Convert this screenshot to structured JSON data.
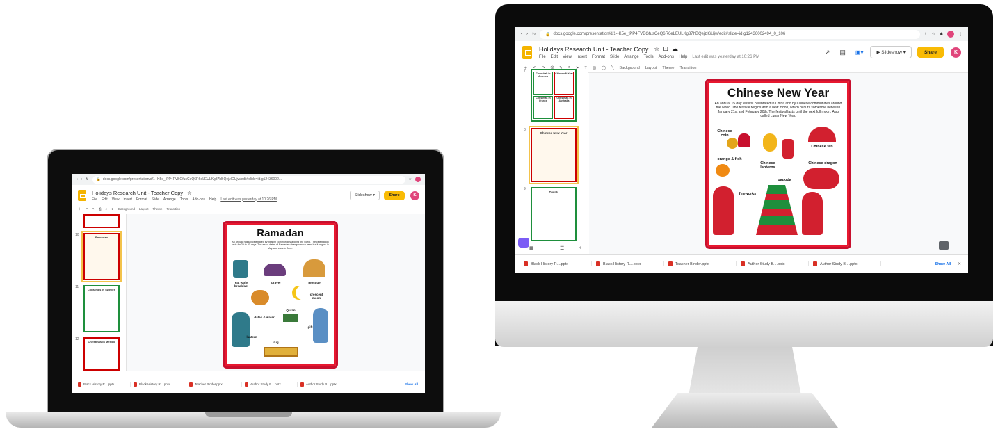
{
  "laptop": {
    "url": "docs.google.com/presentation/d/1--K5e_tPP4FVBGfusCeQ6R6eLEULKg87hBQejzlGUjw/edit#slide=id.g12436002...",
    "doc_title": "Holidays Research Unit - Teacher Copy",
    "menu": [
      "File",
      "Edit",
      "View",
      "Insert",
      "Format",
      "Slide",
      "Arrange",
      "Tools",
      "Add-ons",
      "Help"
    ],
    "last_edit": "Last edit was yesterday at 10:26 PM",
    "slideshow_label": "Slideshow",
    "share_label": "Share",
    "avatar_letter": "K",
    "toolbar_items": [
      "Background",
      "Layout",
      "Theme",
      "Transition"
    ],
    "slide_title": "Ramadan",
    "slide_desc": "An annual holiday celebrated by Muslim communities around the world. The celebration lasts for 29 to 30 days. The exact dates of Ramadan changes each year, but it begins in May and ends in June.",
    "labels": {
      "breakfast": "eat early breakfast",
      "prayer": "prayer",
      "mosque": "mosque",
      "moon": "crescent moon",
      "dates": "dates & water",
      "quran": "Quran",
      "gift": "gift",
      "lantern": "lantern",
      "rug": "rug"
    },
    "thumb_numbers": [
      "10",
      "11",
      "12"
    ],
    "thumb_titles": [
      "Ramadan",
      "Christmas in Sweden",
      "Christmas in Mexico"
    ],
    "downloads": [
      "Black History R....pptx",
      "Black History R....pptx",
      "Teacher Binder.pptx",
      "Author Study B....pptx",
      "Author Study B....pptx"
    ],
    "show_all": "Show All"
  },
  "monitor": {
    "url": "docs.google.com/presentation/d/1--K5e_tPP4FVBGfusCeQ6R6eLEULKg87hBQejzlGUjw/edit#slide=id.g12436002494_0_106",
    "doc_title": "Holidays Research Unit - Teacher Copy",
    "menu": [
      "File",
      "Edit",
      "View",
      "Insert",
      "Format",
      "Slide",
      "Arrange",
      "Tools",
      "Add-ons",
      "Help"
    ],
    "last_edit": "Last edit was yesterday at 10:26 PM",
    "slideshow_label": "Slideshow",
    "share_label": "Share",
    "avatar_letter": "K",
    "toolbar_items": [
      "Background",
      "Layout",
      "Theme",
      "Transition"
    ],
    "slide_title": "Chinese New Year",
    "slide_desc": "An annual 15 day festival celebrated in China and by Chinese communities around the world. The festival begins with a new moon, which occurs sometime between January 21st and February 20th. The festival lasts until the next full moon. Also called Lunar New Year.",
    "labels": {
      "coin": "Chinese coin",
      "fan": "Chinese fan",
      "orange": "orange & fish",
      "lanterns": "Chinese lanterns",
      "dragon": "Chinese dragon",
      "pagoda": "pagoda",
      "fireworks": "fireworks"
    },
    "thumb_numbers": [
      "7",
      "8",
      "9"
    ],
    "thumb_titles": [
      "Chinese New Year",
      "Diwali"
    ],
    "top_thumb_cells": [
      "Chanukah in America",
      "Chinese N Year",
      "Christmas in France",
      "Christmas in Australia"
    ],
    "downloads": [
      "Black History R....pptx",
      "Black History R....pptx",
      "Teacher Binder.pptx",
      "Author Study B....pptx",
      "Author Study B....pptx"
    ],
    "show_all": "Show All"
  },
  "colors": {
    "slide_border": "#c8102e",
    "slides_yellow": "#f4b400",
    "avatar": "#e0457b",
    "bezel": "#111111"
  }
}
